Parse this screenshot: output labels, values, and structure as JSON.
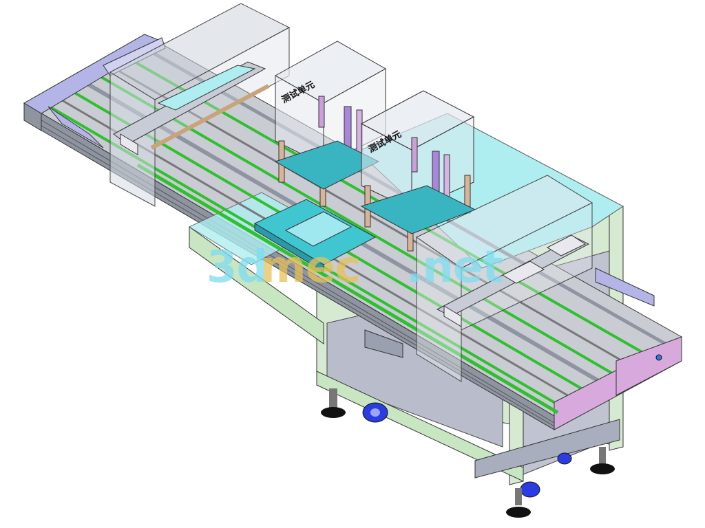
{
  "unit_label_1": "测试单元",
  "unit_label_2": "测试单元",
  "watermark": {
    "part1": "3d",
    "part2": "mec",
    "part3": ".net"
  },
  "colors": {
    "frame_green": "#c9e6c3",
    "rail_green": "#2fbf2f",
    "rail_gray": "#8e95a0",
    "table_cyan": "#aeeef0",
    "cover_purple": "#b4b4e6",
    "end_pink": "#d7a9dc",
    "caster_blue": "#2b3de0",
    "watermark_cyan": "#7fdcf0",
    "watermark_gold": "#e6c25a"
  }
}
